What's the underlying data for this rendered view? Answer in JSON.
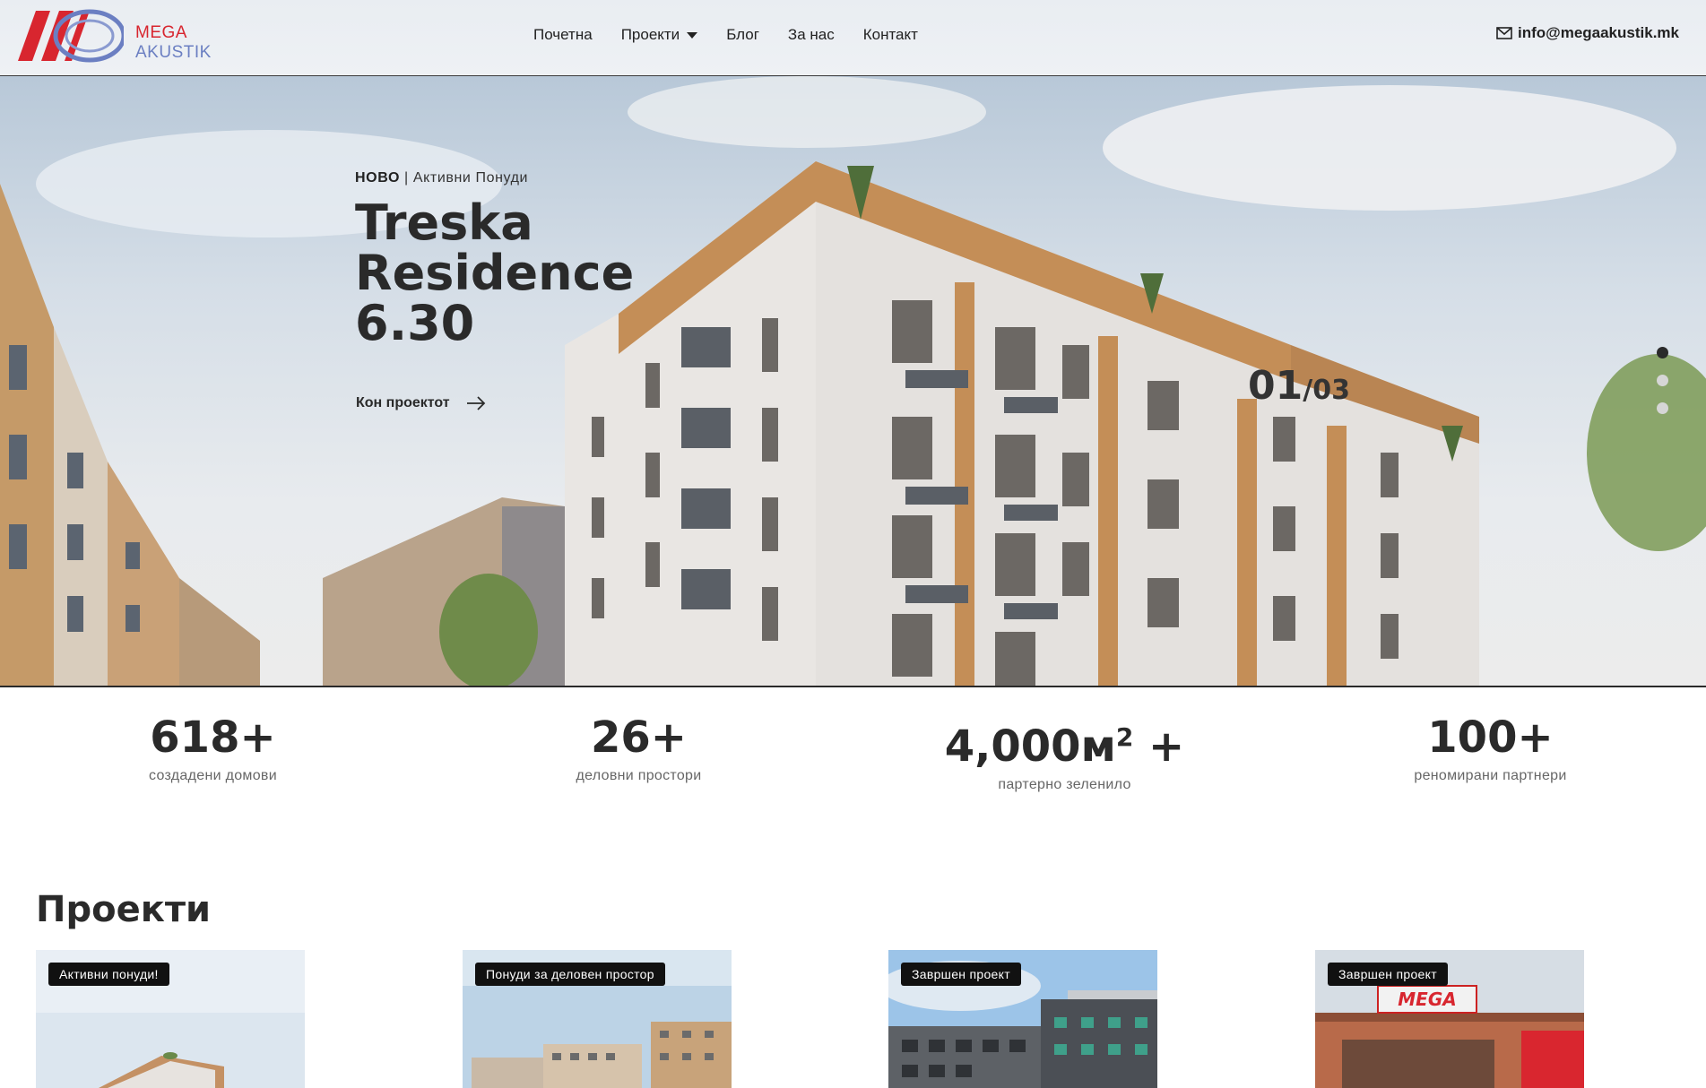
{
  "header": {
    "logo": {
      "line1": "MEGA",
      "line2": "AKUSTIK",
      "icon": "mega-akustik-logo"
    },
    "nav": [
      {
        "label": "Почетна"
      },
      {
        "label": "Проекти",
        "has_dropdown": true
      },
      {
        "label": "Блог"
      },
      {
        "label": "За нас"
      },
      {
        "label": "Контакт"
      }
    ],
    "email": {
      "icon": "envelope-icon",
      "text": "info@megaakustik.mk"
    }
  },
  "hero": {
    "kicker_bold": "НОВО",
    "kicker_rest": " | Активни Понуди",
    "title_lines": [
      "Treska",
      "Residence",
      "6.30"
    ],
    "cta_label": "Кон проектот",
    "cta_icon": "arrow-right-icon",
    "counter_current": "01",
    "counter_total": "/03",
    "slides_total": 3,
    "active_slide": 1
  },
  "stats": [
    {
      "value": "618+",
      "label": "создадени домови"
    },
    {
      "value": "26+",
      "label": "деловни простори"
    },
    {
      "value_main": "4,000м",
      "value_sup": "2",
      "value_tail": " +",
      "label": "партерно зеленило"
    },
    {
      "value": "100+",
      "label": "реномирани партнери"
    }
  ],
  "projects": {
    "title": "Проекти",
    "cards": [
      {
        "badge": "Активни понуди!"
      },
      {
        "badge": "Понуди за деловен простор"
      },
      {
        "badge": "Завршен проект"
      },
      {
        "badge": "Завршен проект",
        "sign": "MEGA"
      }
    ]
  },
  "colors": {
    "brand_red": "#d8262f",
    "brand_blue": "#6b7fc2",
    "text_dark": "#2a2a2a",
    "badge_bg": "#111111"
  }
}
